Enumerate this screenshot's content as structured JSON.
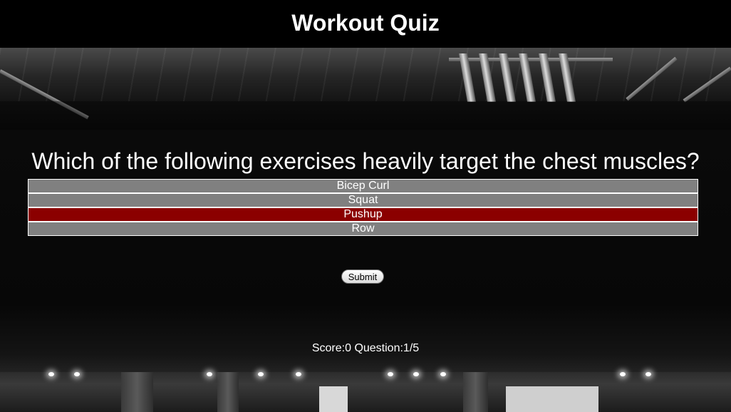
{
  "header": {
    "title": "Workout Quiz"
  },
  "quiz": {
    "question": "Which of the following exercises heavily target the chest muscles?",
    "options": [
      {
        "label": "Bicep Curl",
        "selected": false
      },
      {
        "label": "Squat",
        "selected": false
      },
      {
        "label": "Pushup",
        "selected": true
      },
      {
        "label": "Row",
        "selected": false
      }
    ],
    "submit_label": "Submit",
    "score_label": "Score:",
    "score": "0",
    "question_label": "Question:",
    "question_progress": "1/5"
  },
  "colors": {
    "option_bg": "#808080",
    "option_selected_bg": "#8b0000",
    "header_bg": "#000000"
  }
}
